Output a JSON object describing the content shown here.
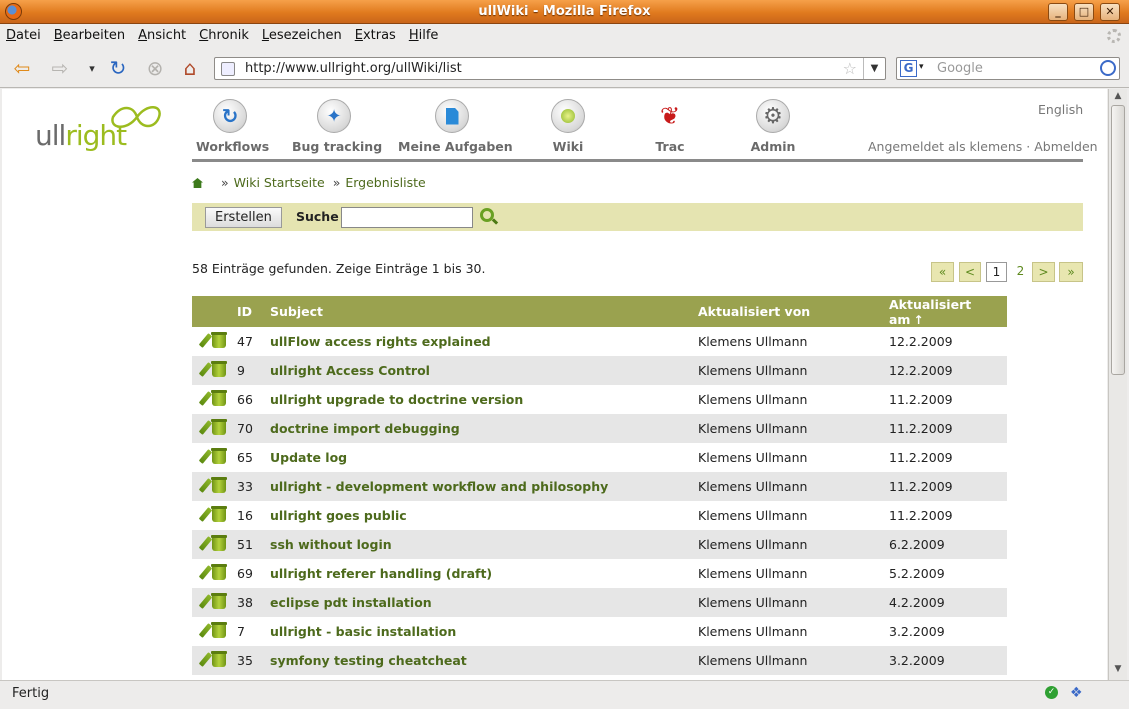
{
  "window": {
    "title": "ullWiki - Mozilla Firefox",
    "min": "_",
    "max": "□",
    "close": "✕"
  },
  "menu": [
    "Datei",
    "Bearbeiten",
    "Ansicht",
    "Chronik",
    "Lesezeichen",
    "Extras",
    "Hilfe"
  ],
  "menu_access": [
    "D",
    "B",
    "A",
    "C",
    "L",
    "E",
    "H"
  ],
  "nav": {
    "url": "http://www.ullright.org/ullWiki/list",
    "search_placeholder": "Google"
  },
  "status": {
    "text": "Fertig"
  },
  "logo": {
    "part1": "ull",
    "part2": "right"
  },
  "apps": [
    {
      "label": "Workflows",
      "icon": "workflows-icon"
    },
    {
      "label": "Bug tracking",
      "icon": "bug-tracking-icon"
    },
    {
      "label": "Meine Aufgaben",
      "icon": "tasks-icon"
    },
    {
      "label": "Wiki",
      "icon": "wiki-icon"
    },
    {
      "label": "Trac",
      "icon": "trac-icon"
    },
    {
      "label": "Admin",
      "icon": "admin-gear-icon"
    }
  ],
  "lang": "English",
  "login": {
    "text": "Angemeldet als klemens",
    "sep": "·",
    "logout": "Abmelden"
  },
  "breadcrumb": {
    "sep": "»",
    "items": [
      "Wiki Startseite",
      "Ergebnisliste"
    ]
  },
  "toolbar": {
    "create": "Erstellen",
    "search_label": "Suche"
  },
  "result": {
    "count": "58 Einträge gefunden. Zeige Einträge 1 bis 30.",
    "pager": {
      "first": "«",
      "prev": "<",
      "current": "1",
      "next_page": "2",
      "next": ">",
      "last": "»"
    }
  },
  "table": {
    "headers": {
      "id": "ID",
      "subject": "Subject",
      "updated_by": "Aktualisiert von",
      "updated_at": "Aktualisiert am",
      "sort": "↑"
    },
    "rows": [
      {
        "id": "47",
        "subject": "ullFlow access rights explained",
        "by": "Klemens Ullmann",
        "at": "12.2.2009"
      },
      {
        "id": "9",
        "subject": "ullright Access Control",
        "by": "Klemens Ullmann",
        "at": "12.2.2009"
      },
      {
        "id": "66",
        "subject": "ullright upgrade to doctrine version",
        "by": "Klemens Ullmann",
        "at": "11.2.2009"
      },
      {
        "id": "70",
        "subject": "doctrine import debugging",
        "by": "Klemens Ullmann",
        "at": "11.2.2009"
      },
      {
        "id": "65",
        "subject": "Update log",
        "by": "Klemens Ullmann",
        "at": "11.2.2009"
      },
      {
        "id": "33",
        "subject": "ullright - development workflow and philosophy",
        "by": "Klemens Ullmann",
        "at": "11.2.2009"
      },
      {
        "id": "16",
        "subject": "ullright goes public",
        "by": "Klemens Ullmann",
        "at": "11.2.2009"
      },
      {
        "id": "51",
        "subject": "ssh without login",
        "by": "Klemens Ullmann",
        "at": "6.2.2009"
      },
      {
        "id": "69",
        "subject": "ullright referer handling (draft)",
        "by": "Klemens Ullmann",
        "at": "5.2.2009"
      },
      {
        "id": "38",
        "subject": "eclipse pdt installation",
        "by": "Klemens Ullmann",
        "at": "4.2.2009"
      },
      {
        "id": "7",
        "subject": "ullright - basic installation",
        "by": "Klemens Ullmann",
        "at": "3.2.2009"
      },
      {
        "id": "35",
        "subject": "symfony testing cheatcheat",
        "by": "Klemens Ullmann",
        "at": "3.2.2009"
      }
    ]
  },
  "colors": {
    "accent": "#9aa24f",
    "toolbar_bg": "#e5e4b1",
    "link": "#4d6a1c",
    "row_alt": "#e6e6e6"
  }
}
